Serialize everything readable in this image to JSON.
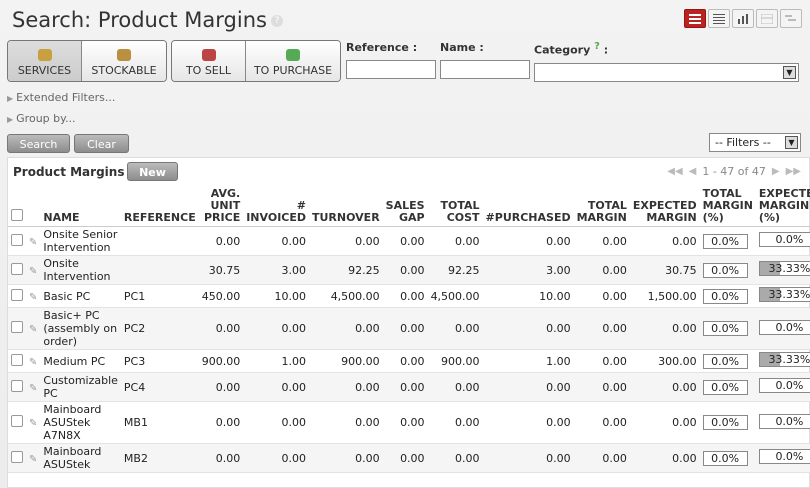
{
  "page": {
    "title": "Search: Product Margins",
    "help": "?"
  },
  "views": [
    "list-view-icon",
    "form-view-icon",
    "graph-view-icon",
    "calendar-view-icon",
    "gantt-view-icon"
  ],
  "filters": {
    "group1": [
      {
        "label": "SERVICES",
        "icon": "services-icon",
        "pressed": true
      },
      {
        "label": "STOCKABLE",
        "icon": "stockable-icon",
        "pressed": false
      }
    ],
    "group2": [
      {
        "label": "TO SELL",
        "icon": "to-sell-icon",
        "pressed": false
      },
      {
        "label": "TO PURCHASE",
        "icon": "to-purchase-icon",
        "pressed": false
      }
    ]
  },
  "fields": {
    "reference": {
      "label": "Reference :",
      "value": ""
    },
    "name": {
      "label": "Name :",
      "value": ""
    },
    "category": {
      "label": "Category",
      "help": "?",
      "colon": ":",
      "value": ""
    }
  },
  "expanders": {
    "extended": "Extended Filters...",
    "group_by": "Group by..."
  },
  "actions": {
    "search": "Search",
    "clear": "Clear",
    "filters_select": "-- Filters --"
  },
  "list": {
    "title": "Product Margins",
    "new_label": "New",
    "pager": "1 - 47 of 47",
    "columns": [
      "NAME",
      "REFERENCE",
      "AVG. UNIT PRICE",
      "# INVOICED",
      "TURNOVER",
      "SALES GAP",
      "TOTAL COST",
      "#PURCHASED",
      "TOTAL MARGIN",
      "EXPECTED MARGIN",
      "TOTAL MARGIN (%)",
      "EXPECTED MARGIN (%)"
    ],
    "rows": [
      {
        "name": "Onsite Senior Intervention",
        "ref": "",
        "price": "0.00",
        "invoiced": "0.00",
        "turnover": "0.00",
        "gap": "0.00",
        "cost": "0.00",
        "purchased": "0.00",
        "margin": "0.00",
        "exp_margin": "0.00",
        "margin_pct": "0.0%",
        "exp_pct": "0.0%",
        "exp_fill": 0
      },
      {
        "name": "Onsite Intervention",
        "ref": "",
        "price": "30.75",
        "invoiced": "3.00",
        "turnover": "92.25",
        "gap": "0.00",
        "cost": "92.25",
        "purchased": "3.00",
        "margin": "0.00",
        "exp_margin": "30.75",
        "margin_pct": "0.0%",
        "exp_pct": "33.33%",
        "exp_fill": 33.33
      },
      {
        "name": "Basic PC",
        "ref": "PC1",
        "price": "450.00",
        "invoiced": "10.00",
        "turnover": "4,500.00",
        "gap": "0.00",
        "cost": "4,500.00",
        "purchased": "10.00",
        "margin": "0.00",
        "exp_margin": "1,500.00",
        "margin_pct": "0.0%",
        "exp_pct": "33.33%",
        "exp_fill": 33.33
      },
      {
        "name": "Basic+ PC (assembly on order)",
        "ref": "PC2",
        "price": "0.00",
        "invoiced": "0.00",
        "turnover": "0.00",
        "gap": "0.00",
        "cost": "0.00",
        "purchased": "0.00",
        "margin": "0.00",
        "exp_margin": "0.00",
        "margin_pct": "0.0%",
        "exp_pct": "0.0%",
        "exp_fill": 0
      },
      {
        "name": "Medium PC",
        "ref": "PC3",
        "price": "900.00",
        "invoiced": "1.00",
        "turnover": "900.00",
        "gap": "0.00",
        "cost": "900.00",
        "purchased": "1.00",
        "margin": "0.00",
        "exp_margin": "300.00",
        "margin_pct": "0.0%",
        "exp_pct": "33.33%",
        "exp_fill": 33.33
      },
      {
        "name": "Customizable PC",
        "ref": "PC4",
        "price": "0.00",
        "invoiced": "0.00",
        "turnover": "0.00",
        "gap": "0.00",
        "cost": "0.00",
        "purchased": "0.00",
        "margin": "0.00",
        "exp_margin": "0.00",
        "margin_pct": "0.0%",
        "exp_pct": "0.0%",
        "exp_fill": 0
      },
      {
        "name": "Mainboard ASUStek A7N8X",
        "ref": "MB1",
        "price": "0.00",
        "invoiced": "0.00",
        "turnover": "0.00",
        "gap": "0.00",
        "cost": "0.00",
        "purchased": "0.00",
        "margin": "0.00",
        "exp_margin": "0.00",
        "margin_pct": "0.0%",
        "exp_pct": "0.0%",
        "exp_fill": 0
      },
      {
        "name": "Mainboard ASUStek",
        "ref": "MB2",
        "price": "0.00",
        "invoiced": "0.00",
        "turnover": "0.00",
        "gap": "0.00",
        "cost": "0.00",
        "purchased": "0.00",
        "margin": "0.00",
        "exp_margin": "0.00",
        "margin_pct": "0.0%",
        "exp_pct": "0.0%",
        "exp_fill": 0
      }
    ]
  }
}
